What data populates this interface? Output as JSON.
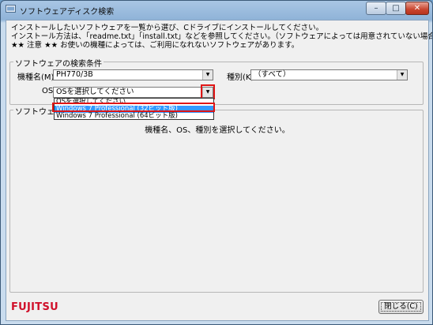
{
  "window": {
    "title": "ソフトウェアディスク検索",
    "min_glyph": "–",
    "max_glyph": "□",
    "close_glyph": "✕"
  },
  "intro": {
    "line1": "インストールしたいソフトウェアを一覧から選び、Cドライブにインストールしてください。",
    "line2": "インストール方法は、「readme.txt」「install.txt」などを参照してください。（ソフトウェアによっては用意されていない場合もあります）",
    "line3": "★★ 注意 ★★ お使いの機種によっては、ご利用になれないソフトウェアがあります。"
  },
  "search": {
    "legend": "ソフトウェアの検索条件",
    "model_label": "機種名(M)",
    "model_value": "PH770/3B",
    "type_label": "種別(K)",
    "type_value": "（すべて）",
    "os_label": "OS(E)",
    "os_value": "OSを選択してください",
    "os_options": [
      "OSを選択してください",
      "Windows 7 Professional (32ビット版)",
      "Windows 7 Professional (64ビット版)"
    ]
  },
  "software": {
    "legend": "ソフトウェア一",
    "status": "機種名、OS、種別を選択してください。"
  },
  "footer": {
    "logo": "FUJITSU",
    "close_label": "閉じる(C)"
  },
  "colors": {
    "highlight": "#e01515",
    "selection": "#3399ff",
    "brand": "#d0102a"
  }
}
